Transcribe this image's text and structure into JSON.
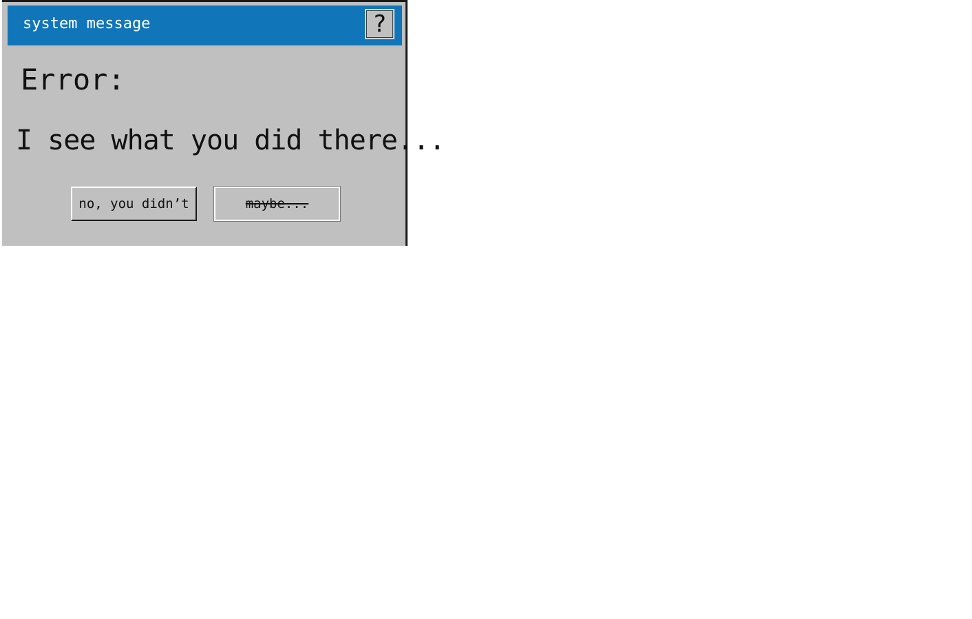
{
  "dialog": {
    "title": "system message",
    "help_symbol": "?",
    "heading": "Error:",
    "message": "I see what you did there...",
    "buttons": {
      "no_label": "no, you didn’t",
      "maybe_label": "maybe..."
    }
  },
  "colors": {
    "titlebar": "#1175b9",
    "dialog_bg": "#c0c0c0",
    "text": "#111111"
  },
  "icons": {
    "help": "question-mark-icon"
  }
}
